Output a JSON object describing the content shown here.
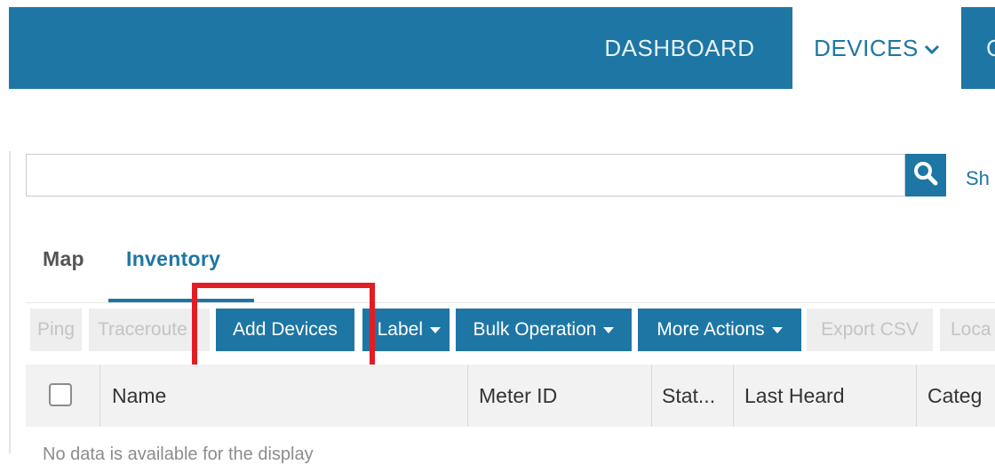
{
  "nav": {
    "dashboard": "DASHBOARD",
    "devices": "DEVICES",
    "next_partial": "C"
  },
  "search": {
    "value": "",
    "placeholder": "",
    "side_link": "Sh"
  },
  "tabs": [
    {
      "label": "Map",
      "active": false
    },
    {
      "label": "Inventory",
      "active": true
    }
  ],
  "toolbar": {
    "ping": "Ping",
    "traceroute": "Traceroute",
    "add_devices": "Add Devices",
    "label": "Label",
    "bulk_operation": "Bulk Operation",
    "more_actions": "More Actions",
    "export_csv": "Export CSV",
    "location": "Loca"
  },
  "table": {
    "columns": [
      "Name",
      "Meter ID",
      "Stat...",
      "Last Heard",
      "Categ"
    ],
    "empty_message": "No data is available for the display"
  },
  "colors": {
    "brand": "#1e76a4",
    "highlight": "#e21d23",
    "disabled_bg": "#eeeeee"
  },
  "icons": {
    "search": "search-icon",
    "chevron": "chevron-down-icon",
    "caret": "caret-down-icon"
  }
}
